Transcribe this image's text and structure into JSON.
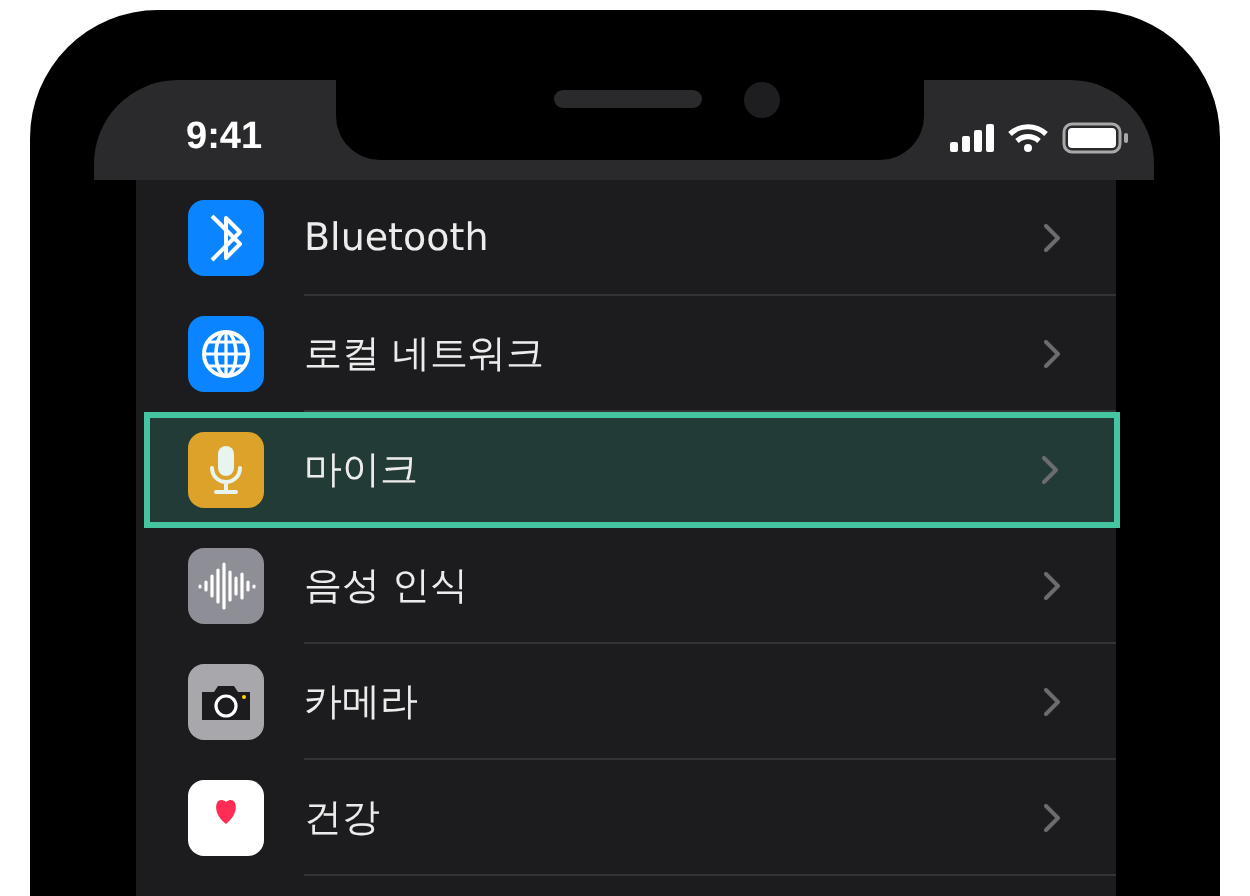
{
  "status_bar": {
    "time": "9:41"
  },
  "settings_list": [
    {
      "label": "Bluetooth",
      "kind": "bluetooth",
      "selected": false
    },
    {
      "label": "로컬 네트워크",
      "kind": "network",
      "selected": false
    },
    {
      "label": "마이크",
      "kind": "microphone",
      "selected": true
    },
    {
      "label": "음성 인식",
      "kind": "speech",
      "selected": false
    },
    {
      "label": "카메라",
      "kind": "camera",
      "selected": false
    },
    {
      "label": "건강",
      "kind": "health",
      "selected": false
    }
  ]
}
